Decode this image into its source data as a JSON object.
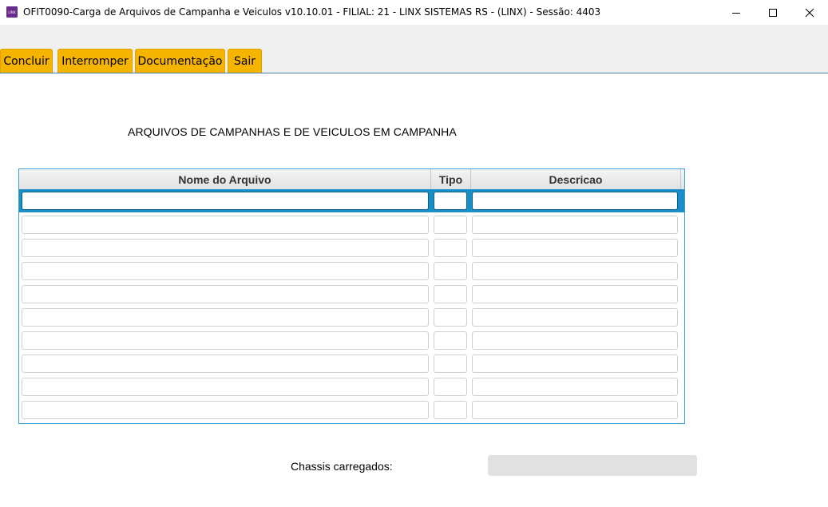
{
  "window": {
    "title": "OFIT0090-Carga de Arquivos de Campanha e Veiculos v10.10.01   - FILIAL: 21 - LINX SISTEMAS RS - (LINX) - Sessão: 4403",
    "icon_text": "LINX",
    "icon_color": "#6a2c8c"
  },
  "toolbar": {
    "accent_color": "#f5b400",
    "buttons": [
      "Concluir",
      "Interromper",
      "Documentação",
      "Sair"
    ]
  },
  "heading": "ARQUIVOS DE CAMPANHAS E DE VEICULOS EM CAMPANHA",
  "table": {
    "columns": [
      "Nome do Arquivo",
      "Tipo",
      "Descricao"
    ],
    "rows": [
      [
        "",
        "",
        ""
      ],
      [
        "",
        "",
        ""
      ],
      [
        "",
        "",
        ""
      ],
      [
        "",
        "",
        ""
      ],
      [
        "",
        "",
        ""
      ],
      [
        "",
        "",
        ""
      ],
      [
        "",
        "",
        ""
      ],
      [
        "",
        "",
        ""
      ],
      [
        "",
        "",
        ""
      ],
      [
        "",
        "",
        ""
      ]
    ],
    "selected_row": 0,
    "selection_color": "#1a8fc7"
  },
  "footer": {
    "chassis_label": "Chassis carregados:",
    "chassis_value": ""
  }
}
